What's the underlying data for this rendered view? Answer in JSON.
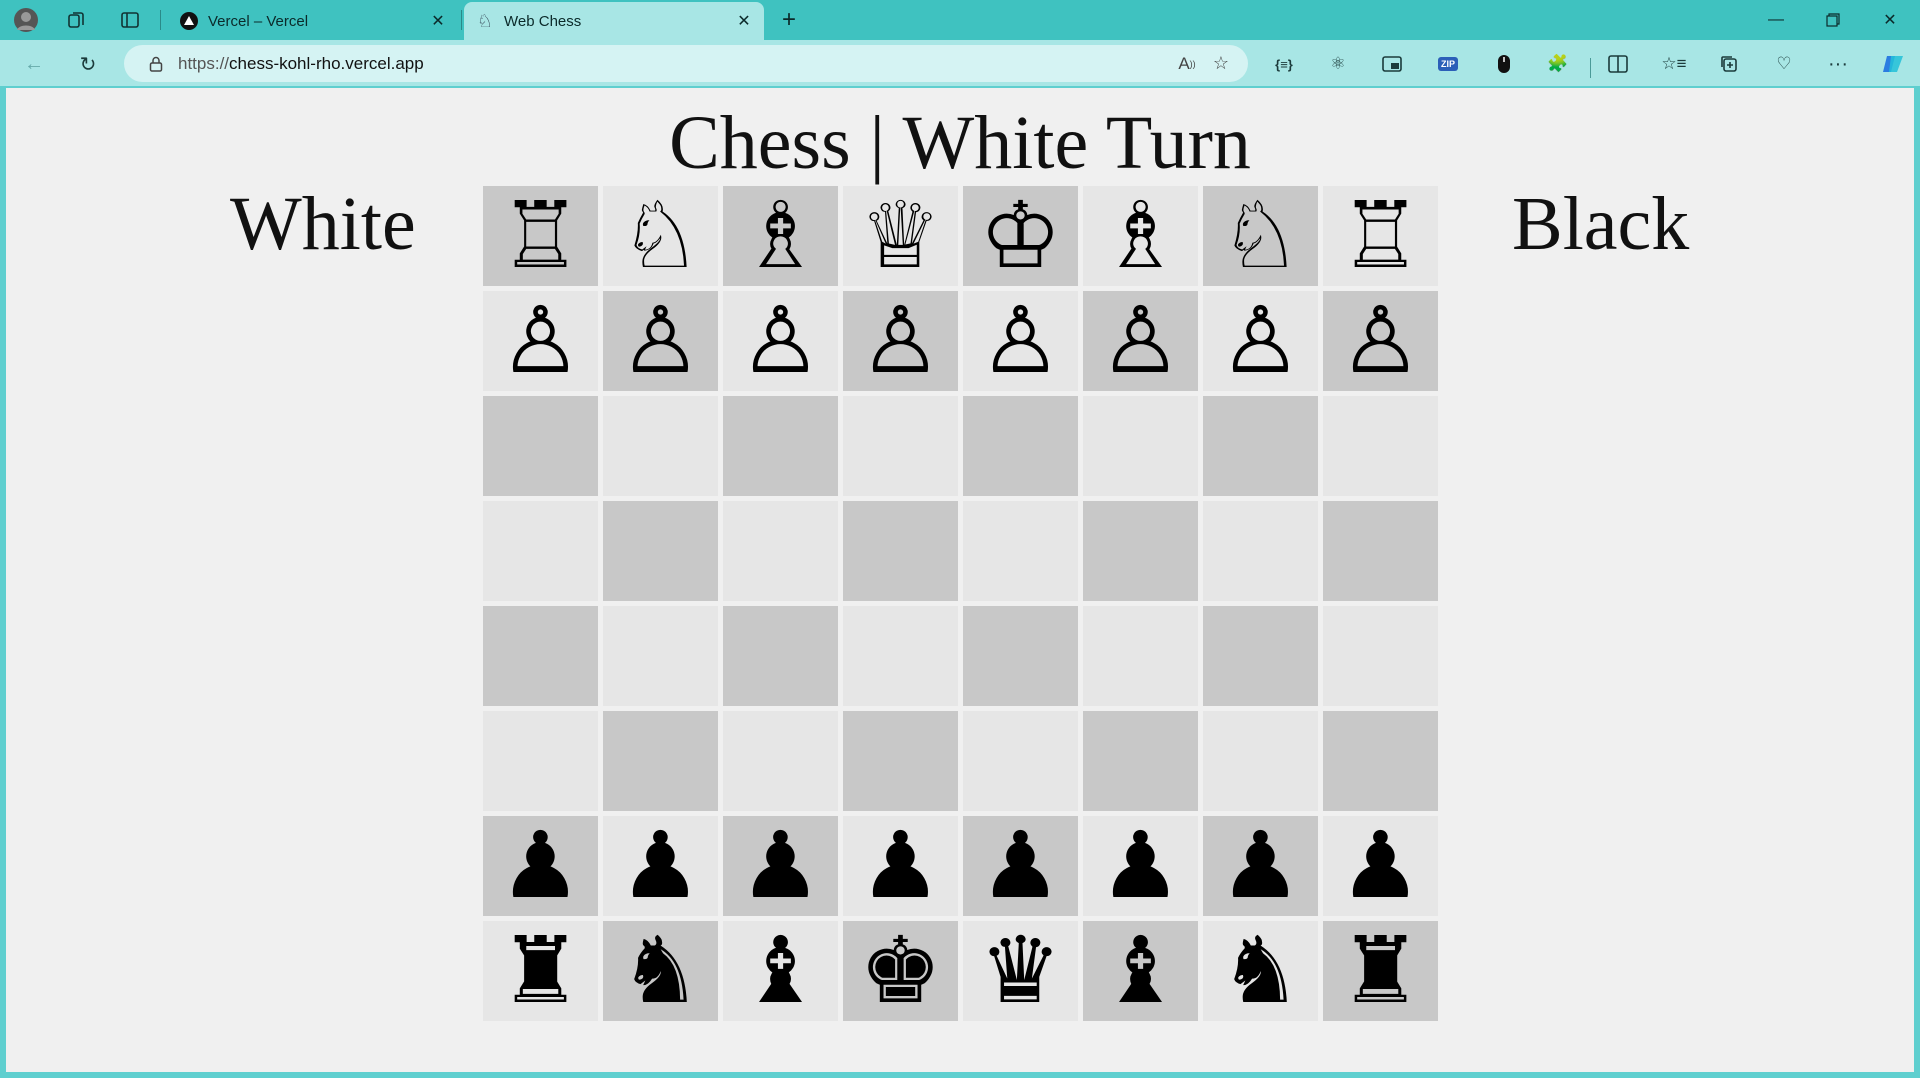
{
  "browser": {
    "tabs": [
      {
        "title": "Vercel – Vercel",
        "favicon": "vercel-triangle-icon",
        "active": false
      },
      {
        "title": "Web Chess",
        "favicon": "chess-icon",
        "active": true
      }
    ],
    "url_prefix": "https://",
    "url_host": "chess-kohl-rho.vercel.app"
  },
  "page": {
    "title": "Chess | White Turn",
    "white_label": "White",
    "black_label": "Black"
  },
  "board": {
    "ranks": [
      [
        "♖",
        "♘",
        "♗",
        "♕",
        "♔",
        "♗",
        "♘",
        "♖"
      ],
      [
        "♙",
        "♙",
        "♙",
        "♙",
        "♙",
        "♙",
        "♙",
        "♙"
      ],
      [
        "",
        "",
        "",
        "",
        "",
        "",
        "",
        ""
      ],
      [
        "",
        "",
        "",
        "",
        "",
        "",
        "",
        ""
      ],
      [
        "",
        "",
        "",
        "",
        "",
        "",
        "",
        ""
      ],
      [
        "",
        "",
        "",
        "",
        "",
        "",
        "",
        ""
      ],
      [
        "♟",
        "♟",
        "♟",
        "♟",
        "♟",
        "♟",
        "♟",
        "♟"
      ],
      [
        "♜",
        "♞",
        "♝",
        "♚",
        "♛",
        "♝",
        "♞",
        "♜"
      ]
    ],
    "names": {
      "♖": "white-rook",
      "♘": "white-knight",
      "♗": "white-bishop",
      "♕": "white-queen",
      "♔": "white-king",
      "♙": "white-pawn",
      "♜": "black-rook",
      "♞": "black-knight",
      "♝": "black-bishop",
      "♛": "black-queen",
      "♚": "black-king",
      "♟": "black-pawn"
    },
    "colors": {
      "dark": "#c8c8c8",
      "light": "#e6e6e6"
    }
  }
}
